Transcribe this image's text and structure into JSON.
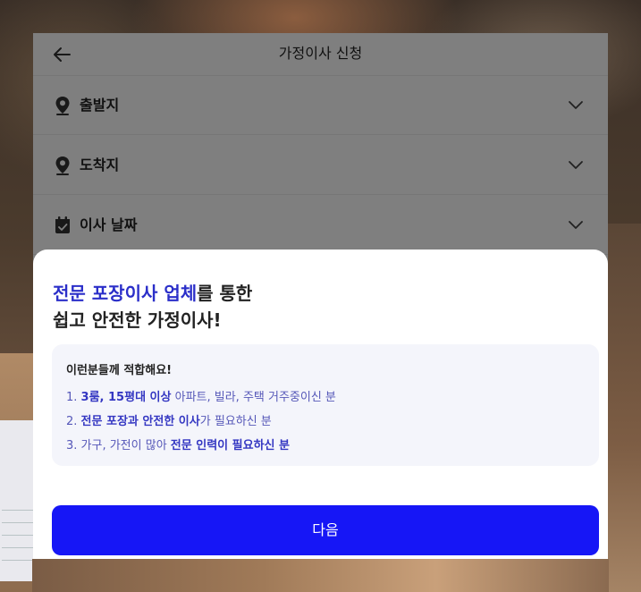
{
  "header": {
    "title": "가정이사 신청"
  },
  "rows": [
    {
      "label": "출발지",
      "icon": "location-pin-icon"
    },
    {
      "label": "도착지",
      "icon": "location-pin-icon"
    },
    {
      "label": "이사 날짜",
      "icon": "calendar-icon"
    }
  ],
  "sheet": {
    "headline_accent": "전문 포장이사 업체",
    "headline_rest_1": "를 통한",
    "headline_line_2": "쉽고 안전한 가정이사!",
    "info_title": "이런분들께 적합해요!",
    "items": [
      {
        "prefix": "1. ",
        "bold": "3룸, 15평대 이상",
        "rest": " 아파트, 빌라, 주택 거주중이신 분"
      },
      {
        "prefix": "2. ",
        "bold": "전문 포장과 안전한 이사",
        "rest": "가 필요하신 분"
      },
      {
        "prefix": "3. 가구, 가전이 많아 ",
        "bold": "전문 인력이 필요하신 분",
        "rest": ""
      }
    ],
    "next_label": "다음"
  },
  "colors": {
    "accent": "#2b2fc9",
    "button": "#1616f6",
    "info_bg": "#f4f5fb",
    "info_text": "#5557b8"
  }
}
